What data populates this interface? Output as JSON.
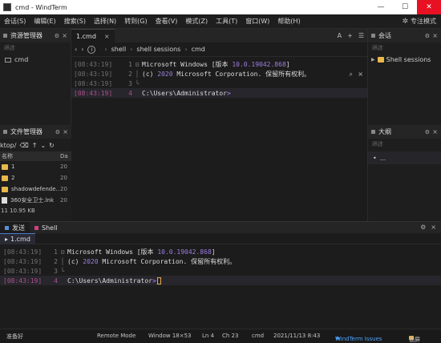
{
  "window": {
    "title": "cmd - WindTerm",
    "min_glyph": "—",
    "max_glyph": "☐",
    "close_glyph": "✕"
  },
  "menu": {
    "items": [
      "会话(S)",
      "编辑(E)",
      "搜索(S)",
      "选择(N)",
      "转到(G)",
      "查看(V)",
      "模式(Z)",
      "工具(T)",
      "窗口(W)",
      "帮助(H)"
    ],
    "focus_mode": "专注模式"
  },
  "explorer": {
    "title": "资源管理器",
    "filter_placeholder": "筛选",
    "items": [
      "cmd"
    ]
  },
  "file_manager": {
    "title": "文件管理器",
    "path": "ktop/",
    "col_name": "名称",
    "col_date": "Da",
    "rows": [
      {
        "name": "1",
        "date": "20",
        "type": "folder"
      },
      {
        "name": "2",
        "date": "20",
        "type": "folder"
      },
      {
        "name": "shadowdefende…",
        "date": "20",
        "type": "folder"
      },
      {
        "name": "360安全卫士.lnk",
        "date": "20",
        "type": "file"
      }
    ],
    "status_count": "11",
    "status_size": "10.95 KB"
  },
  "editor": {
    "tab_label": "1.cmd",
    "tab_close": "×",
    "tools": [
      "A",
      "+",
      "☰"
    ],
    "breadcrumbs": [
      "shell",
      "shell sessions",
      "cmd"
    ],
    "lines": [
      {
        "ts": "[08:43:19]",
        "ln": "1",
        "fold": "⊟",
        "pre": "Microsoft Windows [版本 ",
        "num": "10.0.19042.868",
        "post": "]"
      },
      {
        "ts": "[08:43:19]",
        "ln": "2",
        "fold": "│",
        "pre": "(c) ",
        "num": "2020",
        "post": " Microsoft Corporation. 保留所有权利。"
      },
      {
        "ts": "[08:43:19]",
        "ln": "3",
        "fold": "└",
        "pre": "",
        "num": "",
        "post": ""
      },
      {
        "ts": "[08:43:19]",
        "ln": "4",
        "fold": "",
        "pre": "C:\\Users\\Administrator",
        "num": "",
        "post": ">"
      }
    ]
  },
  "sessions": {
    "title": "会话",
    "filter_placeholder": "筛选",
    "items": [
      "Shell sessions"
    ]
  },
  "outline": {
    "title": "大纲",
    "filter_placeholder": "筛选",
    "items": [
      "..."
    ]
  },
  "bottom": {
    "tabs": [
      "发送",
      "Shell"
    ],
    "subtab": "1.cmd",
    "lines": [
      {
        "ts": "[08:43:19]",
        "ln": "1",
        "fold": "⊟",
        "pre": "Microsoft Windows [版本 ",
        "num": "10.0.19042.868",
        "post": "]"
      },
      {
        "ts": "[08:43:19]",
        "ln": "2",
        "fold": "│",
        "pre": "(c) ",
        "num": "2020",
        "post": " Microsoft Corporation. 保留所有权利。"
      },
      {
        "ts": "[08:43:19]",
        "ln": "3",
        "fold": "└",
        "pre": "",
        "num": "",
        "post": ""
      },
      {
        "ts": "[08:43:19]",
        "ln": "4",
        "fold": "",
        "pre": "C:\\Users\\Administrator",
        "num": "",
        "post": ">"
      }
    ]
  },
  "status": {
    "ready": "准备好",
    "mode": "Remote Mode",
    "window_size": "Window 18×53",
    "line": "Ln 4",
    "col": "Ch 23",
    "session": "cmd",
    "datetime": "2021/11/13 8:43",
    "issues": "WindTerm Issues",
    "lock": "锁屏"
  },
  "colors": {
    "accent": "#4aa3ff",
    "number": "#9c7de0",
    "current_line_ts": "#b0508c",
    "close_red": "#e81123",
    "folder": "#e8b84a"
  }
}
